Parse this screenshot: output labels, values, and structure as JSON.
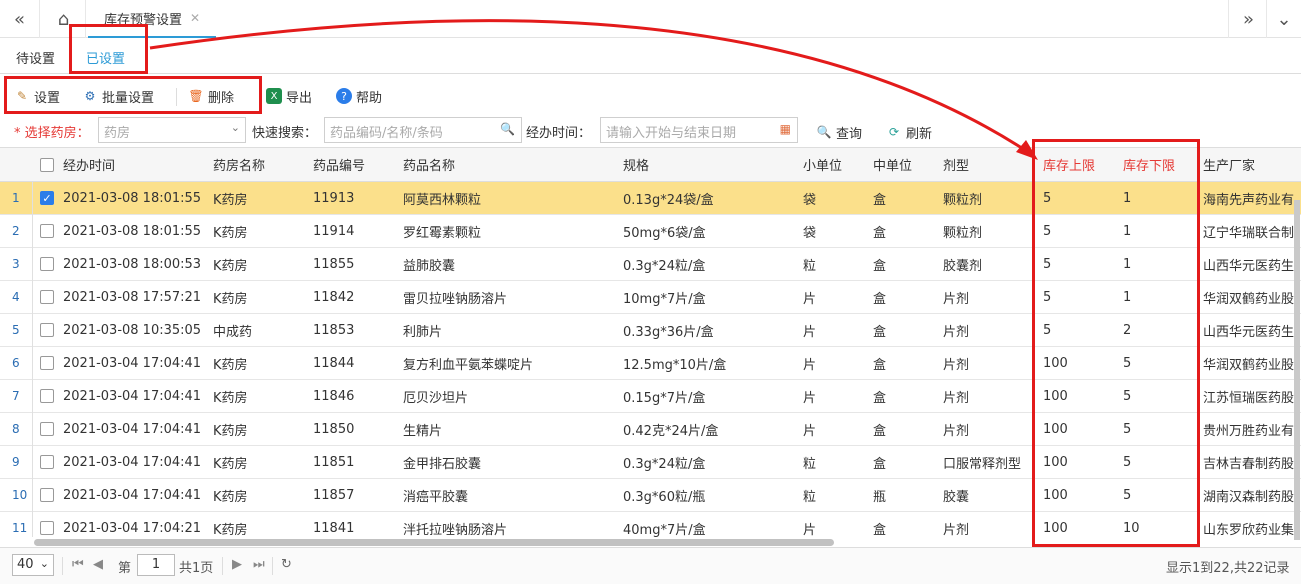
{
  "topbar": {
    "back_all_icon": "«",
    "home_icon": "⌂",
    "page_tab": {
      "label": "库存预警设置",
      "close": "✕"
    },
    "forward_all_icon": "»",
    "menu_icon": "⌄"
  },
  "subtabs": [
    "待设置",
    "已设置"
  ],
  "toolbar": {
    "set": "设置",
    "batch_set": "批量设置",
    "delete": "删除",
    "export": "导出",
    "help": "帮助"
  },
  "filter": {
    "pharmacy_label": "* 选择药房：",
    "pharmacy_placeholder": "药房",
    "quick_search_label": "快速搜索：",
    "search_placeholder": "药品编码/名称/条码",
    "time_label": "经办时间：",
    "date_placeholder": "请输入开始与结束日期",
    "query": "查询",
    "refresh": "刷新"
  },
  "columns": [
    "经办时间",
    "药房名称",
    "药品编号",
    "药品名称",
    "规格",
    "小单位",
    "中单位",
    "剂型",
    "库存上限",
    "库存下限",
    "生产厂家"
  ],
  "rows": [
    {
      "n": "1",
      "checked": true,
      "time": "2021-03-08 18:01:55",
      "pharmacy": "K药房",
      "code": "11913",
      "name": "阿莫西林颗粒",
      "spec": "0.13g*24袋/盒",
      "small": "袋",
      "mid": "盒",
      "form": "颗粒剂",
      "max": "5",
      "min": "1",
      "maker": "海南先声药业有"
    },
    {
      "n": "2",
      "checked": false,
      "time": "2021-03-08 18:01:55",
      "pharmacy": "K药房",
      "code": "11914",
      "name": "罗红霉素颗粒",
      "spec": "50mg*6袋/盒",
      "small": "袋",
      "mid": "盒",
      "form": "颗粒剂",
      "max": "5",
      "min": "1",
      "maker": "辽宁华瑞联合制"
    },
    {
      "n": "3",
      "checked": false,
      "time": "2021-03-08 18:00:53",
      "pharmacy": "K药房",
      "code": "11855",
      "name": "益肺胶囊",
      "spec": "0.3g*24粒/盒",
      "small": "粒",
      "mid": "盒",
      "form": "胶囊剂",
      "max": "5",
      "min": "1",
      "maker": "山西华元医药生"
    },
    {
      "n": "4",
      "checked": false,
      "time": "2021-03-08 17:57:21",
      "pharmacy": "K药房",
      "code": "11842",
      "name": "雷贝拉唑钠肠溶片",
      "spec": "10mg*7片/盒",
      "small": "片",
      "mid": "盒",
      "form": "片剂",
      "max": "5",
      "min": "1",
      "maker": "华润双鹤药业股"
    },
    {
      "n": "5",
      "checked": false,
      "time": "2021-03-08 10:35:05",
      "pharmacy": "中成药",
      "code": "11853",
      "name": "利肺片",
      "spec": "0.33g*36片/盒",
      "small": "片",
      "mid": "盒",
      "form": "片剂",
      "max": "5",
      "min": "2",
      "maker": "山西华元医药生"
    },
    {
      "n": "6",
      "checked": false,
      "time": "2021-03-04 17:04:41",
      "pharmacy": "K药房",
      "code": "11844",
      "name": "复方利血平氨苯蝶啶片",
      "spec": "12.5mg*10片/盒",
      "small": "片",
      "mid": "盒",
      "form": "片剂",
      "max": "100",
      "min": "5",
      "maker": "华润双鹤药业股"
    },
    {
      "n": "7",
      "checked": false,
      "time": "2021-03-04 17:04:41",
      "pharmacy": "K药房",
      "code": "11846",
      "name": "厄贝沙坦片",
      "spec": "0.15g*7片/盒",
      "small": "片",
      "mid": "盒",
      "form": "片剂",
      "max": "100",
      "min": "5",
      "maker": "江苏恒瑞医药股"
    },
    {
      "n": "8",
      "checked": false,
      "time": "2021-03-04 17:04:41",
      "pharmacy": "K药房",
      "code": "11850",
      "name": "生精片",
      "spec": "0.42克*24片/盒",
      "small": "片",
      "mid": "盒",
      "form": "片剂",
      "max": "100",
      "min": "5",
      "maker": "贵州万胜药业有"
    },
    {
      "n": "9",
      "checked": false,
      "time": "2021-03-04 17:04:41",
      "pharmacy": "K药房",
      "code": "11851",
      "name": "金甲排石胶囊",
      "spec": "0.3g*24粒/盒",
      "small": "粒",
      "mid": "盒",
      "form": "口服常释剂型",
      "max": "100",
      "min": "5",
      "maker": "吉林吉春制药股"
    },
    {
      "n": "10",
      "checked": false,
      "time": "2021-03-04 17:04:41",
      "pharmacy": "K药房",
      "code": "11857",
      "name": "消癌平胶囊",
      "spec": "0.3g*60粒/瓶",
      "small": "粒",
      "mid": "瓶",
      "form": "胶囊",
      "max": "100",
      "min": "5",
      "maker": "湖南汉森制药股"
    },
    {
      "n": "11",
      "checked": false,
      "time": "2021-03-04 17:04:21",
      "pharmacy": "K药房",
      "code": "11841",
      "name": "泮托拉唑钠肠溶片",
      "spec": "40mg*7片/盒",
      "small": "片",
      "mid": "盒",
      "form": "片剂",
      "max": "100",
      "min": "10",
      "maker": "山东罗欣药业集"
    }
  ],
  "pager": {
    "page_size": "40",
    "page_prefix": "第",
    "page_value": "1",
    "page_suffix": "共1页",
    "summary": "显示1到22,共22记录"
  },
  "colors": {
    "accent": "#2d9bd6",
    "selected_row": "#fbe08b",
    "annotation": "#e31b1b",
    "required": "#e53935"
  }
}
